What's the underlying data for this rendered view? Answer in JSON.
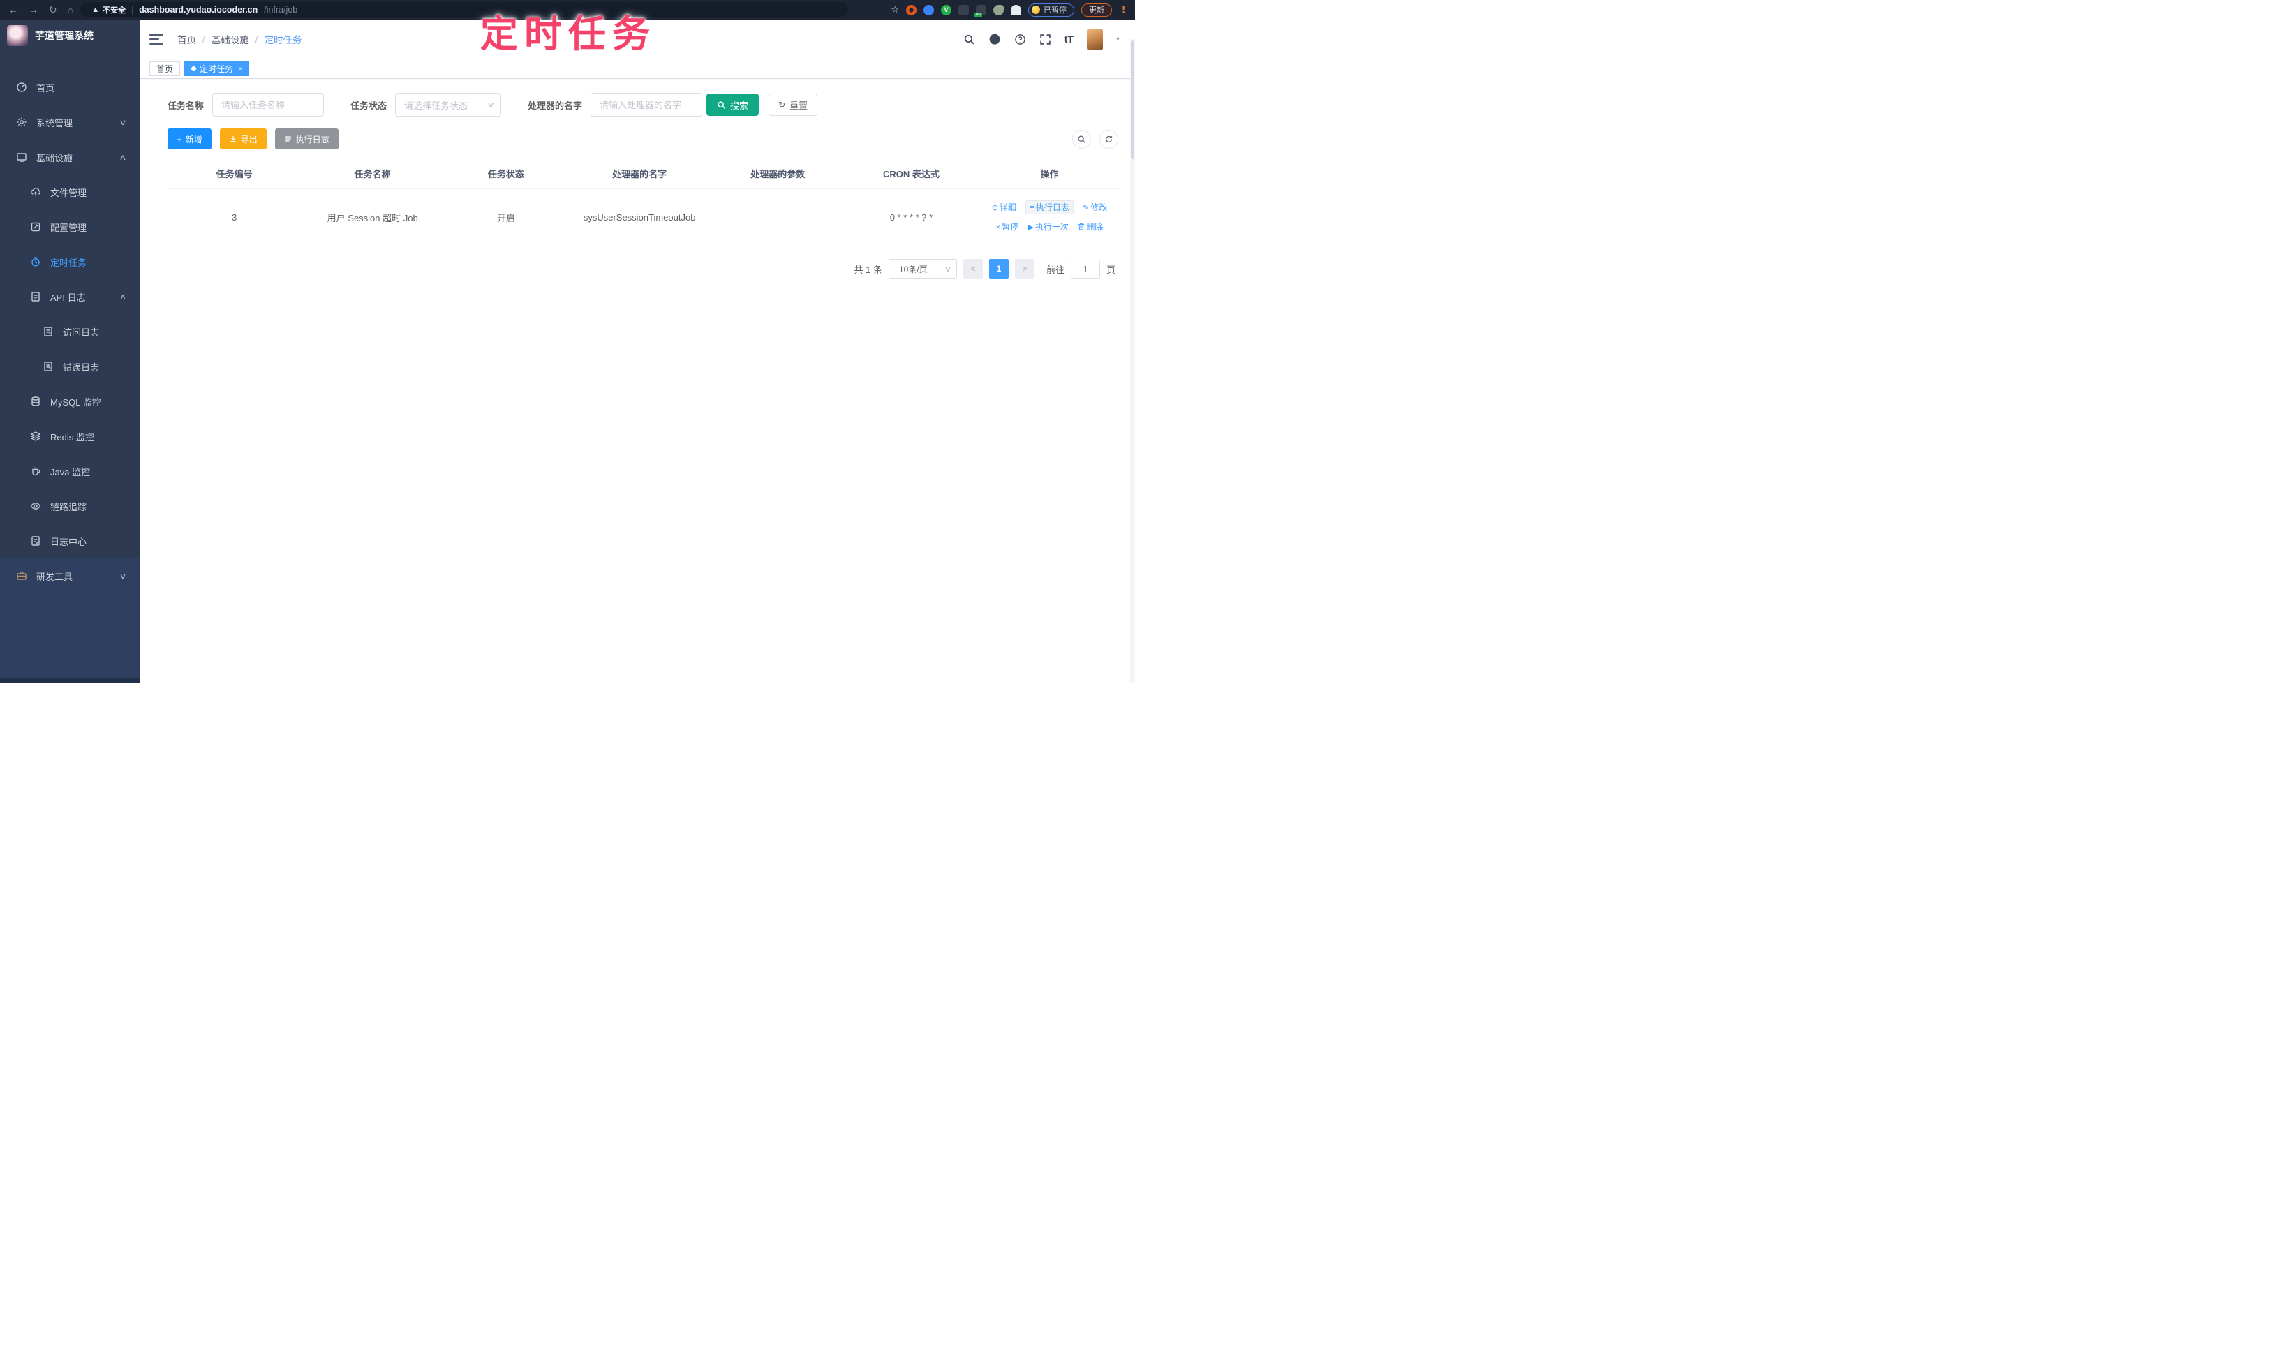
{
  "browser": {
    "security_label": "不安全",
    "url_host": "dashboard.yudao.iocoder.cn",
    "url_path": "/infra/job",
    "paused_badge": "已暂停",
    "update_label": "更新"
  },
  "annotation": {
    "text": "定时任务",
    "color": "#f5426b"
  },
  "sidebar": {
    "title": "芋道管理系统",
    "items": [
      {
        "label": "首页",
        "icon": "home-icon"
      },
      {
        "label": "系统管理",
        "icon": "gear-icon",
        "chevron": "down"
      },
      {
        "label": "基础设施",
        "icon": "infra-icon",
        "chevron": "up"
      },
      {
        "label": "文件管理",
        "icon": "cloud-upload-icon"
      },
      {
        "label": "配置管理",
        "icon": "edit-square-icon"
      },
      {
        "label": "定时任务",
        "icon": "timer-icon",
        "active": true
      },
      {
        "label": "API 日志",
        "icon": "api-log-icon",
        "chevron": "up"
      },
      {
        "label": "访问日志",
        "icon": "access-log-icon"
      },
      {
        "label": "错误日志",
        "icon": "error-log-icon"
      },
      {
        "label": "MySQL 监控",
        "icon": "mysql-monitor-icon"
      },
      {
        "label": "Redis 监控",
        "icon": "redis-monitor-icon"
      },
      {
        "label": "Java 监控",
        "icon": "java-monitor-icon"
      },
      {
        "label": "链路追踪",
        "icon": "trace-icon"
      },
      {
        "label": "日志中心",
        "icon": "log-center-icon"
      },
      {
        "label": "研发工具",
        "icon": "devtools-icon",
        "chevron": "down"
      }
    ]
  },
  "header": {
    "breadcrumb": [
      "首页",
      "基础设施",
      "定时任务"
    ],
    "font_size_icon_text": "tT"
  },
  "tabs": [
    {
      "label": "首页",
      "active": false
    },
    {
      "label": "定时任务",
      "active": true
    }
  ],
  "filters": {
    "name_label": "任务名称",
    "name_placeholder": "请输入任务名称",
    "status_label": "任务状态",
    "status_placeholder": "请选择任务状态",
    "handler_label": "处理器的名字",
    "handler_placeholder": "请输入处理器的名字",
    "search_label": "搜索",
    "reset_label": "重置"
  },
  "toolbar": {
    "add_label": "新增",
    "export_label": "导出",
    "exec_log_label": "执行日志"
  },
  "table": {
    "headers": [
      "任务编号",
      "任务名称",
      "任务状态",
      "处理器的名字",
      "处理器的参数",
      "CRON 表达式",
      "操作"
    ],
    "rows": [
      {
        "id": "3",
        "name": "用户 Session 超时 Job",
        "status": "开启",
        "handler": "sysUserSessionTimeoutJob",
        "param": "",
        "cron": "0 * * * * ? *",
        "ops": [
          "详细",
          "执行日志",
          "修改",
          "暂停",
          "执行一次",
          "删除"
        ]
      }
    ]
  },
  "pagination": {
    "total": "共 1 条",
    "page_size": "10条/页",
    "current_page": "1",
    "goto_label": "前往",
    "goto_value": "1",
    "unit_label": "页"
  },
  "colors": {
    "accent": "#409eff",
    "primary_button": "#1890ff",
    "search_button": "#11a983",
    "export_button": "#fbad15",
    "info_button": "#909399",
    "annotation": "#f5426b",
    "sidebar_bg": "#2d3a52",
    "browser_bar_bg": "#1d2534"
  }
}
